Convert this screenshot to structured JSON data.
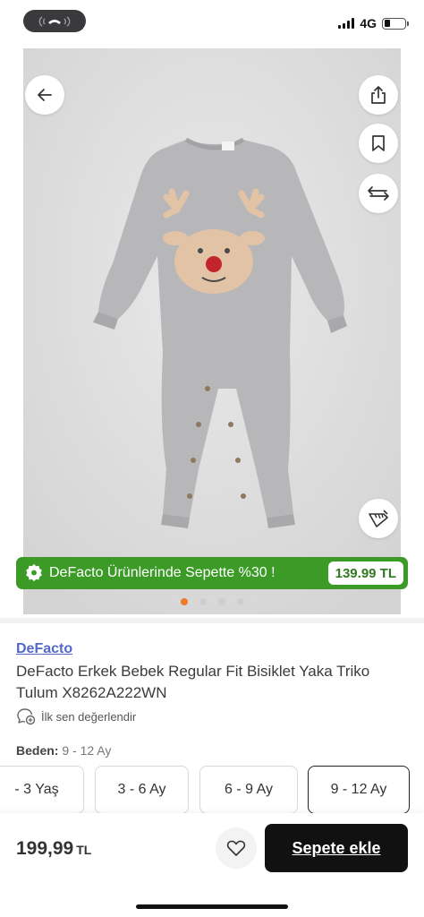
{
  "status_bar": {
    "network": "4G",
    "battery_level": 0.3
  },
  "promo": {
    "text": "DeFacto Ürünlerinde Sepette %30 !",
    "price": "139.99 TL"
  },
  "carousel": {
    "count": 4,
    "active_index": 0
  },
  "product": {
    "brand": "DeFacto",
    "title": "DeFacto Erkek Bebek Regular Fit Bisiklet Yaka Triko Tulum X8262A222WN",
    "rate_prompt": "İlk sen değerlendir",
    "size_label": "Beden:",
    "size_value": "9 - 12 Ay",
    "sizes": [
      "- 3 Yaş",
      "3 - 6 Ay",
      "6 - 9  Ay",
      "9 - 12 Ay"
    ],
    "selected_size": "9 - 12 Ay"
  },
  "bottom_bar": {
    "price": "199,99",
    "currency": "TL",
    "add_to_cart": "Sepete ekle"
  },
  "colors": {
    "accent_green": "#3c9b27",
    "brand_link": "#5468c8",
    "active_dot": "#f0782a",
    "cart_button": "#111111"
  }
}
